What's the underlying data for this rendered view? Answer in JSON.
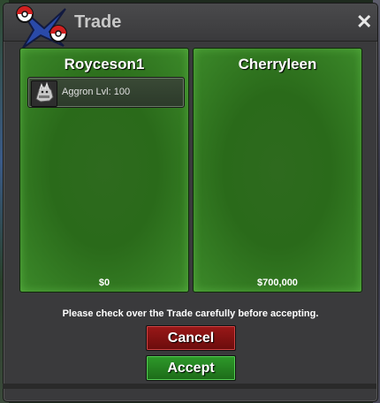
{
  "window": {
    "title": "Trade",
    "close_label": "✕"
  },
  "left_panel": {
    "trainer": "Royceson1",
    "items": [
      {
        "pokemon": "Aggron",
        "level_text": "Lvl: 100",
        "icon": "aggron-sprite-icon"
      }
    ],
    "money": "$0"
  },
  "right_panel": {
    "trainer": "Cherryleen",
    "items": [],
    "money": "$700,000"
  },
  "notice": "Please check over the Trade carefully before accepting.",
  "buttons": {
    "cancel_label": "Cancel",
    "accept_label": "Accept"
  },
  "colors": {
    "panel_green": "#2e6a1e",
    "cancel_red": "#9a1818",
    "accept_green": "#2e9a2a",
    "window_gray": "#3a3a3c"
  }
}
